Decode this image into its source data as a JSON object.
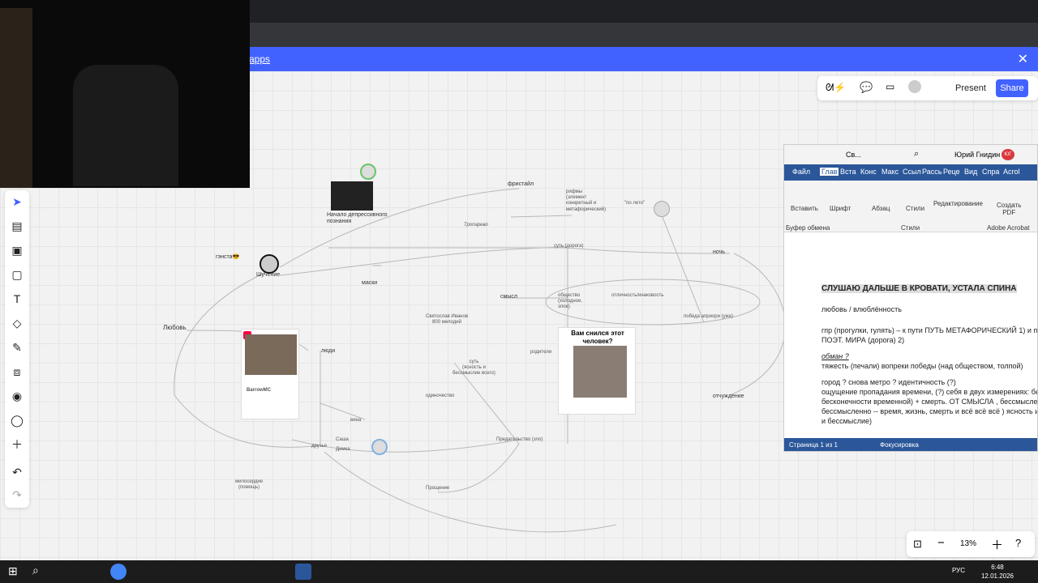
{
  "banner": {
    "text": "apps",
    "close": "✕"
  },
  "collab": {
    "present": "Present",
    "share": "Share"
  },
  "board": {
    "nodes": {
      "freestyle": "фристайл",
      "start_dep": "Начало депрессивного\nпознания",
      "gangsta": "гэнста😎",
      "shuchenie": "Шучение",
      "love": "Любовь",
      "masks": "маски",
      "people": "люди",
      "sense": "смысл",
      "suti": "суть (дорога)",
      "triller": "Тропарево",
      "rifmy": "рифмы\n(элемент\nконкретный и\nметафорический)",
      "po_leto": "\"по лето\"",
      "night": "ночь",
      "obshestvo": "общество\n(холодное,\nзлое)",
      "otlich": "отличность/инаковость",
      "pobeda": "победа априори (уже)",
      "svyatoslav": "Святослав Иванов\n800 мелодий",
      "parents": "родители",
      "suti2": "суть\n(ясность и\nбессмыслие всего)",
      "loneliness": "одиночество",
      "guilt": "вина",
      "friends": "друзья",
      "mercy": "милосердие\n(помощь)",
      "betrayal": "Предательство (зло)",
      "forgiveness": "Прощение",
      "alienation": "отчуждение",
      "dream_title": "Вам снился этот человек?",
      "card_name": "BarrowMC",
      "sasha": "Саша",
      "dimka": "Димка"
    }
  },
  "word": {
    "title_doc": "Св...",
    "user": "Юрий Гнидин",
    "user_initials": "ЮГ",
    "tabs": [
      "Файл",
      "Глав",
      "Встa",
      "Конс",
      "Макс",
      "Ссыл",
      "Рассь",
      "Реце",
      "Вид",
      "Спра",
      "Acrol"
    ],
    "groups": {
      "paste": "Вставить",
      "font": "Шрифт",
      "para": "Абзац",
      "styles": "Стили",
      "edit": "Редактирование",
      "pdf": "Создать\nPDF",
      "clipboard": "Буфер обмена",
      "styles2": "Стили",
      "acrobat": "Adobe Acrobat"
    },
    "doc": {
      "heading": "СЛУШАЮ ДАЛЬШЕ В КРОВАТИ, УСТАЛА СПИНА",
      "l1": "любовь / влюблённость",
      "l2": "гпр (прогулки, гулять) – к пути ПУТЬ МЕТАФОРИЧЕСКИЙ 1) и пут",
      "l3": "ПОЭТ. МИРА (дорога) 2)",
      "l4": "обман ?",
      "l5": "тяжесть (печали) вопреки победы (над обществом, толпой)",
      "l6": "город ?  снова метро ? идентичность (?)",
      "l7": "ощущение пропадания времени,  (?) себя в двух измерениях: бе",
      "l8": "бесконечности временной) + смерть. ОТ СМЫСЛА , бессмыслен",
      "l9": "бессмысленно -- время, жизнь, смерть и всё всё всё ) ясность и с",
      "l10": "и бессмыслие)"
    },
    "status": {
      "page": "Страница 1 из 1",
      "focus": "Фокусировка"
    }
  },
  "zoom": {
    "value": "13%"
  },
  "taskbar": {
    "time": "6:48",
    "date": "12.01.2026",
    "lang": "РУС"
  }
}
